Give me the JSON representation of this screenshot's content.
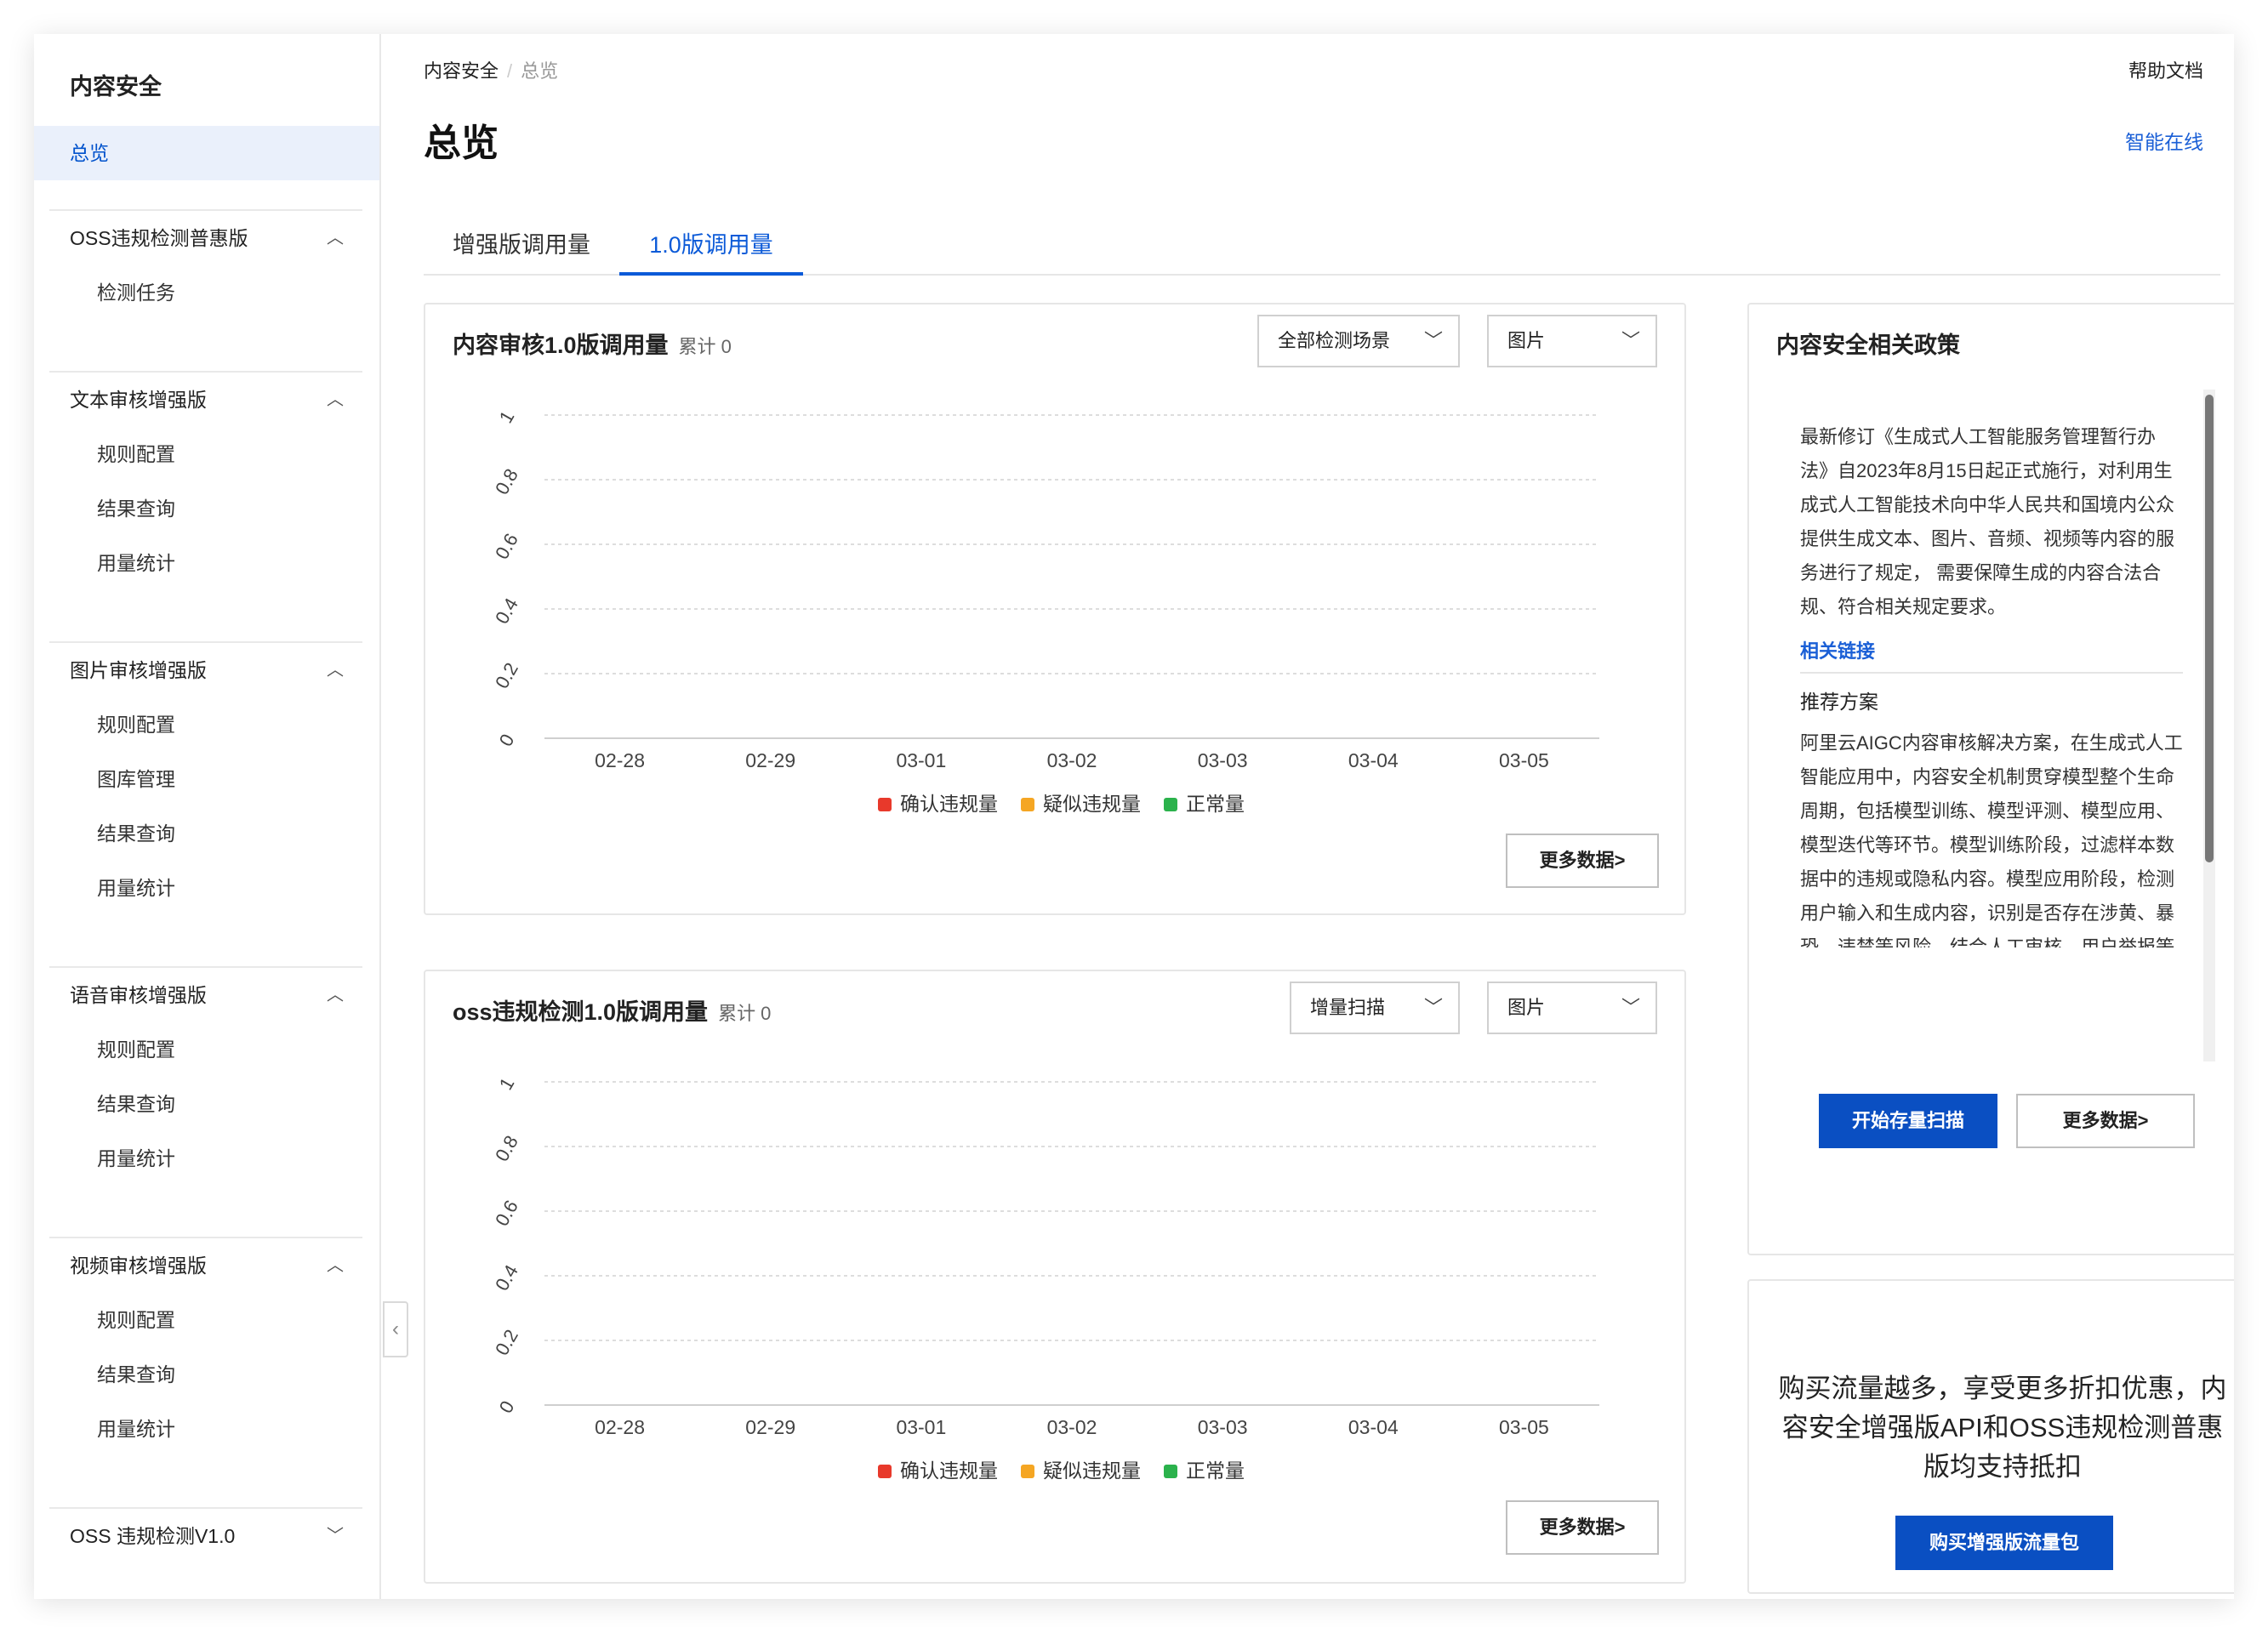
{
  "sidebar": {
    "title": "内容安全",
    "active_item": "总览",
    "groups": [
      {
        "label": "OSS违规检测普惠版",
        "items": [
          "检测任务"
        ]
      },
      {
        "label": "文本审核增强版",
        "items": [
          "规则配置",
          "结果查询",
          "用量统计"
        ]
      },
      {
        "label": "图片审核增强版",
        "items": [
          "规则配置",
          "图库管理",
          "结果查询",
          "用量统计"
        ]
      },
      {
        "label": "语音审核增强版",
        "items": [
          "规则配置",
          "结果查询",
          "用量统计"
        ]
      },
      {
        "label": "视频审核增强版",
        "items": [
          "规则配置",
          "结果查询",
          "用量统计"
        ]
      },
      {
        "label": "OSS 违规检测V1.0",
        "items": []
      }
    ]
  },
  "header": {
    "breadcrumb": [
      "内容安全",
      "总览"
    ],
    "help": "帮助文档",
    "title": "总览",
    "smart_online": "智能在线"
  },
  "tabs": [
    {
      "label": "增强版调用量",
      "active": false
    },
    {
      "label": "1.0版调用量",
      "active": true
    }
  ],
  "cards": [
    {
      "title": "内容审核1.0版调用量",
      "total": "累计 0",
      "select1": "全部检测场景",
      "select2": "图片",
      "more": "更多数据>"
    },
    {
      "title": "oss违规检测1.0版调用量",
      "total": "累计 0",
      "select1": "增量扫描",
      "select2": "图片",
      "more": "更多数据>"
    }
  ],
  "chart_data": [
    {
      "type": "line",
      "x": [
        "02-28",
        "02-29",
        "03-01",
        "03-02",
        "03-03",
        "03-04",
        "03-05"
      ],
      "yticks": [
        "0",
        "0.2",
        "0.4",
        "0.6",
        "0.8",
        "1"
      ],
      "ylim": [
        0,
        1
      ],
      "grid": true,
      "legend_position": "bottom",
      "series": [
        {
          "name": "确认违规量",
          "color": "#e8392b",
          "values": [
            0,
            0,
            0,
            0,
            0,
            0,
            0
          ]
        },
        {
          "name": "疑似违规量",
          "color": "#f5a623",
          "values": [
            0,
            0,
            0,
            0,
            0,
            0,
            0
          ]
        },
        {
          "name": "正常量",
          "color": "#2bb24c",
          "values": [
            0,
            0,
            0,
            0,
            0,
            0,
            0
          ]
        }
      ]
    },
    {
      "type": "line",
      "x": [
        "02-28",
        "02-29",
        "03-01",
        "03-02",
        "03-03",
        "03-04",
        "03-05"
      ],
      "yticks": [
        "0",
        "0.2",
        "0.4",
        "0.6",
        "0.8",
        "1"
      ],
      "ylim": [
        0,
        1
      ],
      "grid": true,
      "legend_position": "bottom",
      "series": [
        {
          "name": "确认违规量",
          "color": "#e8392b",
          "values": [
            0,
            0,
            0,
            0,
            0,
            0,
            0
          ]
        },
        {
          "name": "疑似违规量",
          "color": "#f5a623",
          "values": [
            0,
            0,
            0,
            0,
            0,
            0,
            0
          ]
        },
        {
          "name": "正常量",
          "color": "#2bb24c",
          "values": [
            0,
            0,
            0,
            0,
            0,
            0,
            0
          ]
        }
      ]
    }
  ],
  "policy": {
    "title": "内容安全相关政策",
    "paragraph": "最新修订《生成式人工智能服务管理暂行办法》自2023年8月15日起正式施行，对利用生成式人工智能技术向中华人民共和国境内公众提供生成文本、图片、音频、视频等内容的服务进行了规定， 需要保障生成的内容合法合规、符合相关规定要求。",
    "link": "相关链接",
    "sub_title": "推荐方案",
    "sub_paragraph": "阿里云AIGC内容审核解决方案，在生成式人工智能应用中，内容安全机制贯穿模型整个生命周期，包括模型训练、模型评测、模型应用、模型迭代等环节。模型训练阶段，过滤样本数据中的违规或隐私内容。模型应用阶段，检测用户输入和生成内容，识别是否存在涉黄、暴恐、违禁等风险。结合人工审核、用户举报等机制，",
    "start_button": "开始存量扫描",
    "more_button": "更多数据>"
  },
  "promo": {
    "text": "购买流量越多，享受更多折扣优惠，内容安全增强版API和OSS违规检测普惠版均支持抵扣",
    "button": "购买增强版流量包"
  }
}
